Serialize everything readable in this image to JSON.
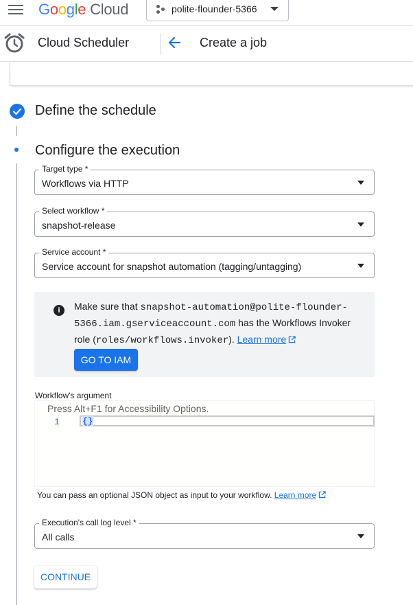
{
  "header": {
    "logo_google_parts": [
      "G",
      "o",
      "o",
      "g",
      "l",
      "e"
    ],
    "logo_cloud": "Cloud",
    "project_name": "polite-flounder-5366"
  },
  "subheader": {
    "product": "Cloud Scheduler",
    "page_title": "Create a job"
  },
  "steps": {
    "step1_title": "Define the schedule",
    "step2_title": "Configure the execution"
  },
  "form": {
    "target_type": {
      "label": "Target type *",
      "value": "Workflows via HTTP"
    },
    "workflow": {
      "label": "Select workflow *",
      "value": "snapshot-release"
    },
    "service_account": {
      "label": "Service account *",
      "value": "Service account for snapshot automation (tagging/untagging)"
    },
    "info": {
      "prefix": "Make sure that ",
      "email": "snapshot-automation@polite-flounder-5366.iam.gserviceaccount.com",
      "middle": " has the Workflows Invoker role (",
      "role": "roles/workflows.invoker",
      "suffix": "). ",
      "link": "Learn more",
      "button": "GO TO IAM"
    },
    "argument": {
      "label": "Workflow's argument",
      "hint": "Press Alt+F1 for Accessibility Options.",
      "line_number": "1",
      "code": "{}"
    },
    "helper": {
      "text": "You can pass an optional JSON object as input to your workflow. ",
      "link": "Learn more"
    },
    "log_level": {
      "label": "Execution's call log level *",
      "value": "All calls"
    },
    "continue": "CONTINUE"
  },
  "colors": {
    "accent": "#1a73e8",
    "info_bg": "#f1f3f4"
  }
}
